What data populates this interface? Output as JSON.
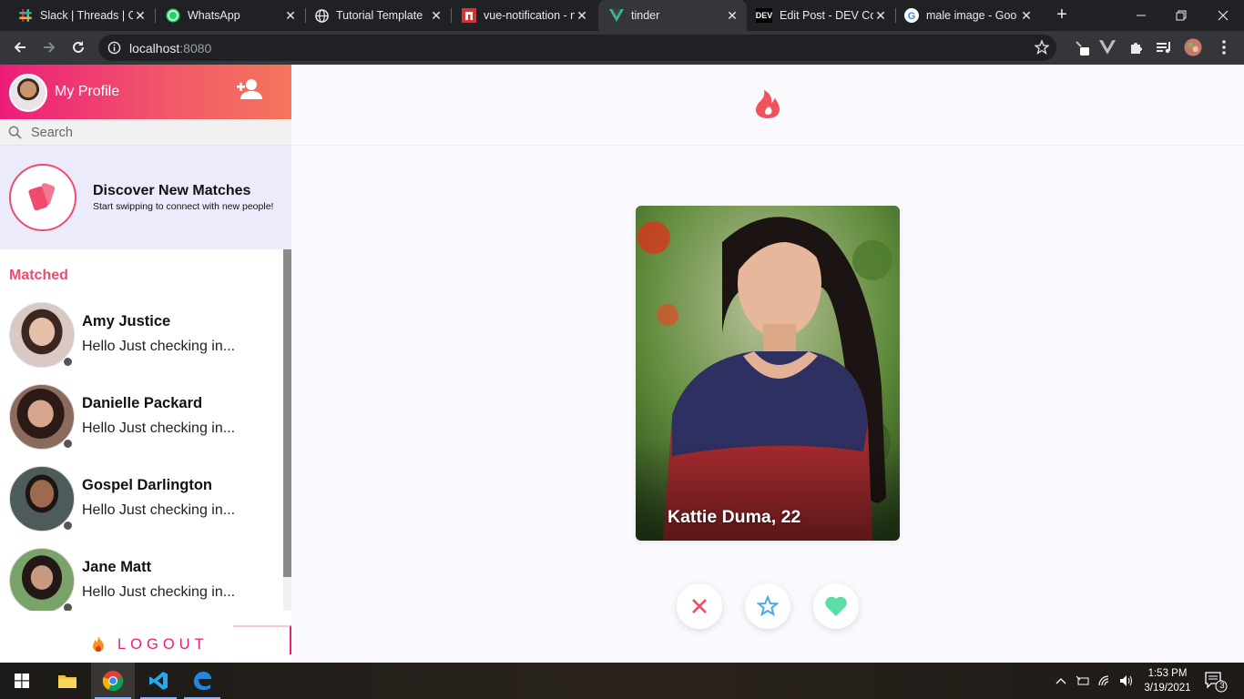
{
  "browser": {
    "tabs": [
      {
        "title": "Slack | Threads | Co",
        "icon": "slack-icon",
        "active": false
      },
      {
        "title": "WhatsApp",
        "icon": "whatsapp-icon",
        "active": false
      },
      {
        "title": "Tutorial Template",
        "icon": "globe-icon",
        "active": false
      },
      {
        "title": "vue-notification - n",
        "icon": "npm-icon",
        "active": false
      },
      {
        "title": "tinder",
        "icon": "vue-icon",
        "active": true
      },
      {
        "title": "Edit Post - DEV Co",
        "icon": "dev-icon",
        "active": false
      },
      {
        "title": "male image - Goo",
        "icon": "google-icon",
        "active": false
      }
    ],
    "url_host": "localhost",
    "url_port": ":8080"
  },
  "sidebar": {
    "profile_title": "My Profile",
    "search_placeholder": "Search",
    "discover_title": "Discover New Matches",
    "discover_subtitle": "Start swipping to connect with new people!",
    "matched_title": "Matched",
    "matches": [
      {
        "name": "Amy Justice",
        "message": "Hello Just checking in..."
      },
      {
        "name": "Danielle Packard",
        "message": "Hello Just checking in..."
      },
      {
        "name": "Gospel Darlington",
        "message": "Hello Just checking in..."
      },
      {
        "name": "Jane Matt",
        "message": "Hello Just checking in..."
      }
    ],
    "logout_label": "LOGOUT"
  },
  "main": {
    "card_name": "Kattie Duma, 22"
  },
  "taskbar": {
    "time": "1:53 PM",
    "date": "3/19/2021",
    "notification_count": "3"
  },
  "colors": {
    "brand_pink": "#ec1d7a",
    "brand_red": "#ef4b6c",
    "discover_bg": "#ebebfb",
    "like_green": "#5cdca6",
    "star_blue": "#4aa8e8"
  }
}
